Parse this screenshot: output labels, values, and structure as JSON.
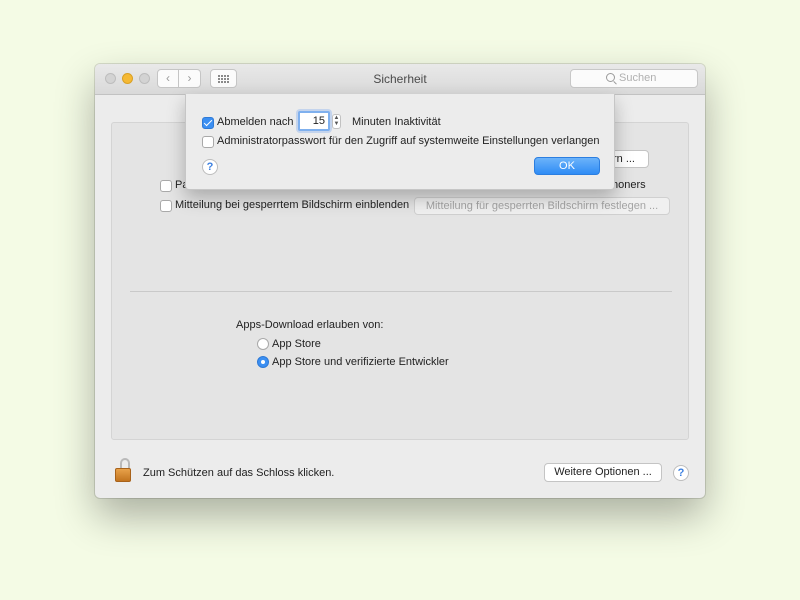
{
  "window": {
    "title": "Sicherheit",
    "search_placeholder": "Suchen"
  },
  "panel": {
    "option_password_label_partial": "Pa",
    "change_button_partial": "rn ...",
    "option_partial_text": "honers",
    "lock_message_label": "Mitteilung bei gesperrtem Bildschirm einblenden",
    "lock_message_button": "Mitteilung für gesperrten Bildschirm festlegen ...",
    "apps_download_label": "Apps-Download erlauben von:",
    "radio_options": [
      {
        "label": "App Store",
        "selected": false
      },
      {
        "label": "App Store und verifizierte Entwickler",
        "selected": true
      }
    ]
  },
  "footer": {
    "lock_text": "Zum Schützen auf das Schloss klicken.",
    "more_options_label": "Weitere Optionen ...",
    "help_label": "?"
  },
  "sheet": {
    "logout_label": "Abmelden nach",
    "logout_checked": true,
    "logout_minutes": "15",
    "logout_suffix": "Minuten Inaktivität",
    "admin_label": "Administratorpasswort für den Zugriff auf systemweite Einstellungen verlangen",
    "admin_checked": false,
    "help_label": "?",
    "ok_label": "OK"
  },
  "colors": {
    "accent": "#3b8ff2",
    "background": "#f4fbe5",
    "window": "#ececec",
    "lock": "#d8892e"
  }
}
